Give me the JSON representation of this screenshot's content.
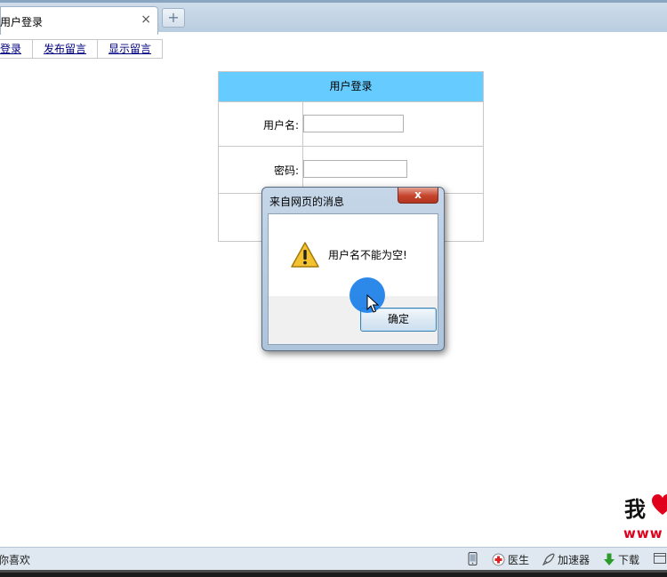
{
  "browser": {
    "tab_title": "用户登录",
    "tab_close": "×",
    "new_tab": "+"
  },
  "nav": {
    "items": [
      "登录",
      "发布留言",
      "显示留言"
    ]
  },
  "login": {
    "title": "用户登录",
    "username_label": "用户名:",
    "username_value": "",
    "password_label": "密码:",
    "password_value": ""
  },
  "dialog": {
    "title": "来自网页的消息",
    "close": "x",
    "message": "用户名不能为空!",
    "ok_label": "确定"
  },
  "watermark": {
    "char": "我",
    "url": "www"
  },
  "statusbar": {
    "left_text": "你喜欢",
    "doctor": "医生",
    "accelerator": "加速器",
    "download": "下载"
  },
  "colors": {
    "login_header": "#66ccff",
    "link": "#000080",
    "accent_blue": "#1a7fe8"
  }
}
